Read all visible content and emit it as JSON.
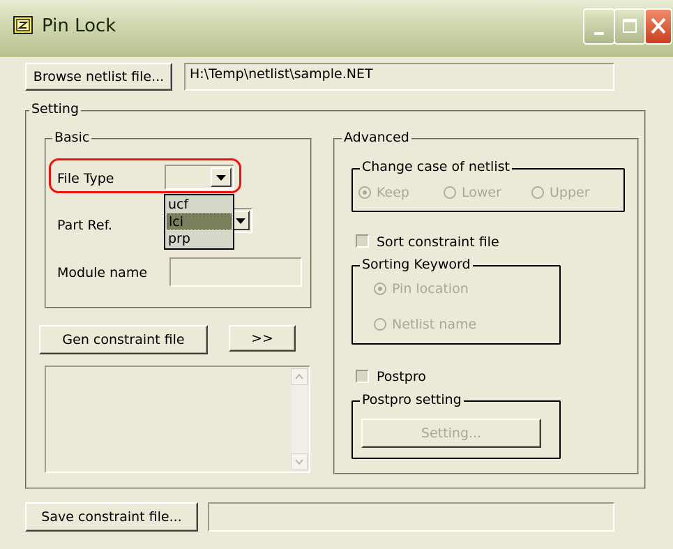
{
  "window": {
    "title": "Pin Lock"
  },
  "netlist": {
    "browse_label": "Browse netlist file...",
    "path": "H:\\Temp\\netlist\\sample.NET"
  },
  "setting": {
    "legend": "Setting",
    "basic": {
      "legend": "Basic",
      "file_type_label": "File Type",
      "file_type_options": [
        "ucf",
        "lci",
        "prp"
      ],
      "file_type_selected": "lci",
      "part_ref_label": "Part Ref.",
      "module_name_label": "Module name",
      "module_name_value": ""
    },
    "gen_button": "Gen constraint file",
    "expand_button": ">>",
    "advanced": {
      "legend": "Advanced",
      "case_group": "Change case of netlist",
      "case_options": [
        "Keep",
        "Lower",
        "Upper"
      ],
      "case_selected": "Keep",
      "sort_checkbox": "Sort constraint file",
      "sort_checked": false,
      "sort_keyword_group": "Sorting Keyword",
      "sort_keyword_options": [
        "Pin location",
        "Netlist name"
      ],
      "sort_keyword_selected": "Pin location",
      "postpro_checkbox": "Postpro",
      "postpro_checked": false,
      "postpro_group": "Postpro setting",
      "postpro_button": "Setting..."
    }
  },
  "save": {
    "button_label": "Save constraint file...",
    "path": ""
  },
  "colors": {
    "face": "#ece9d8",
    "highlight_ring": "#ee1111",
    "selected_item": "#7a7e5a"
  }
}
